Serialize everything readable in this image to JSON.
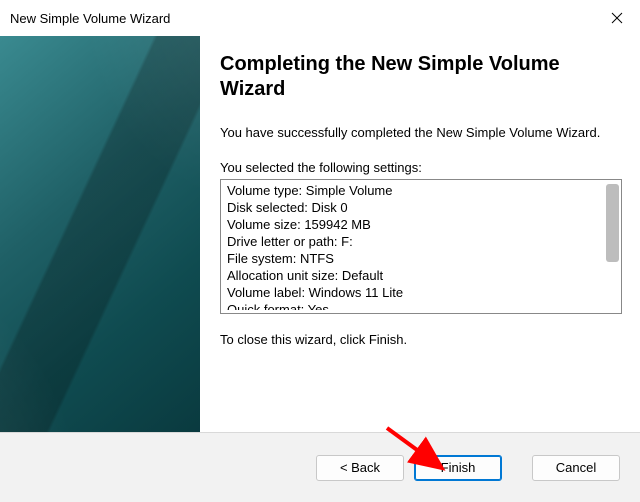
{
  "window": {
    "title": "New Simple Volume Wizard"
  },
  "page": {
    "heading": "Completing the New Simple Volume Wizard",
    "success_msg": "You have successfully completed the New Simple Volume Wizard.",
    "settings_label": "You selected the following settings:",
    "close_note": "To close this wizard, click Finish."
  },
  "settings_lines": [
    "Volume type: Simple Volume",
    "Disk selected: Disk 0",
    "Volume size: 159942 MB",
    "Drive letter or path: F:",
    "File system: NTFS",
    "Allocation unit size: Default",
    "Volume label: Windows 11 Lite",
    "Quick format: Yes"
  ],
  "buttons": {
    "back": "< Back",
    "finish": "Finish",
    "cancel": "Cancel"
  }
}
